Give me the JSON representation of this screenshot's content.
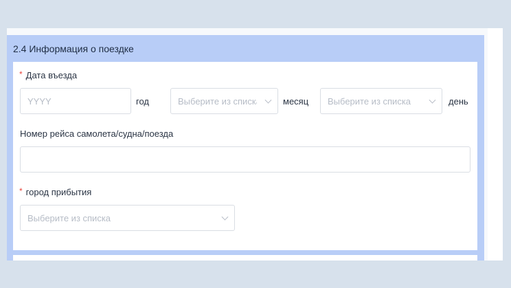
{
  "section": {
    "title": "2.4 Информация о поездке"
  },
  "entry_date": {
    "label": "Дата въезда",
    "required_mark": "*",
    "year_placeholder": "YYYY",
    "year_unit": "год",
    "month_placeholder": "Выберите из списка",
    "month_unit": "месяц",
    "day_placeholder": "Выберите из списка",
    "day_unit": "день"
  },
  "flight_number": {
    "label": "Номер рейса самолета/судна/поезда",
    "value": ""
  },
  "arrival_city": {
    "label": "город прибытия",
    "required_mark": "*",
    "placeholder": "Выберите из списка"
  },
  "icons": {
    "select_arrow": "chevron-down-icon"
  }
}
